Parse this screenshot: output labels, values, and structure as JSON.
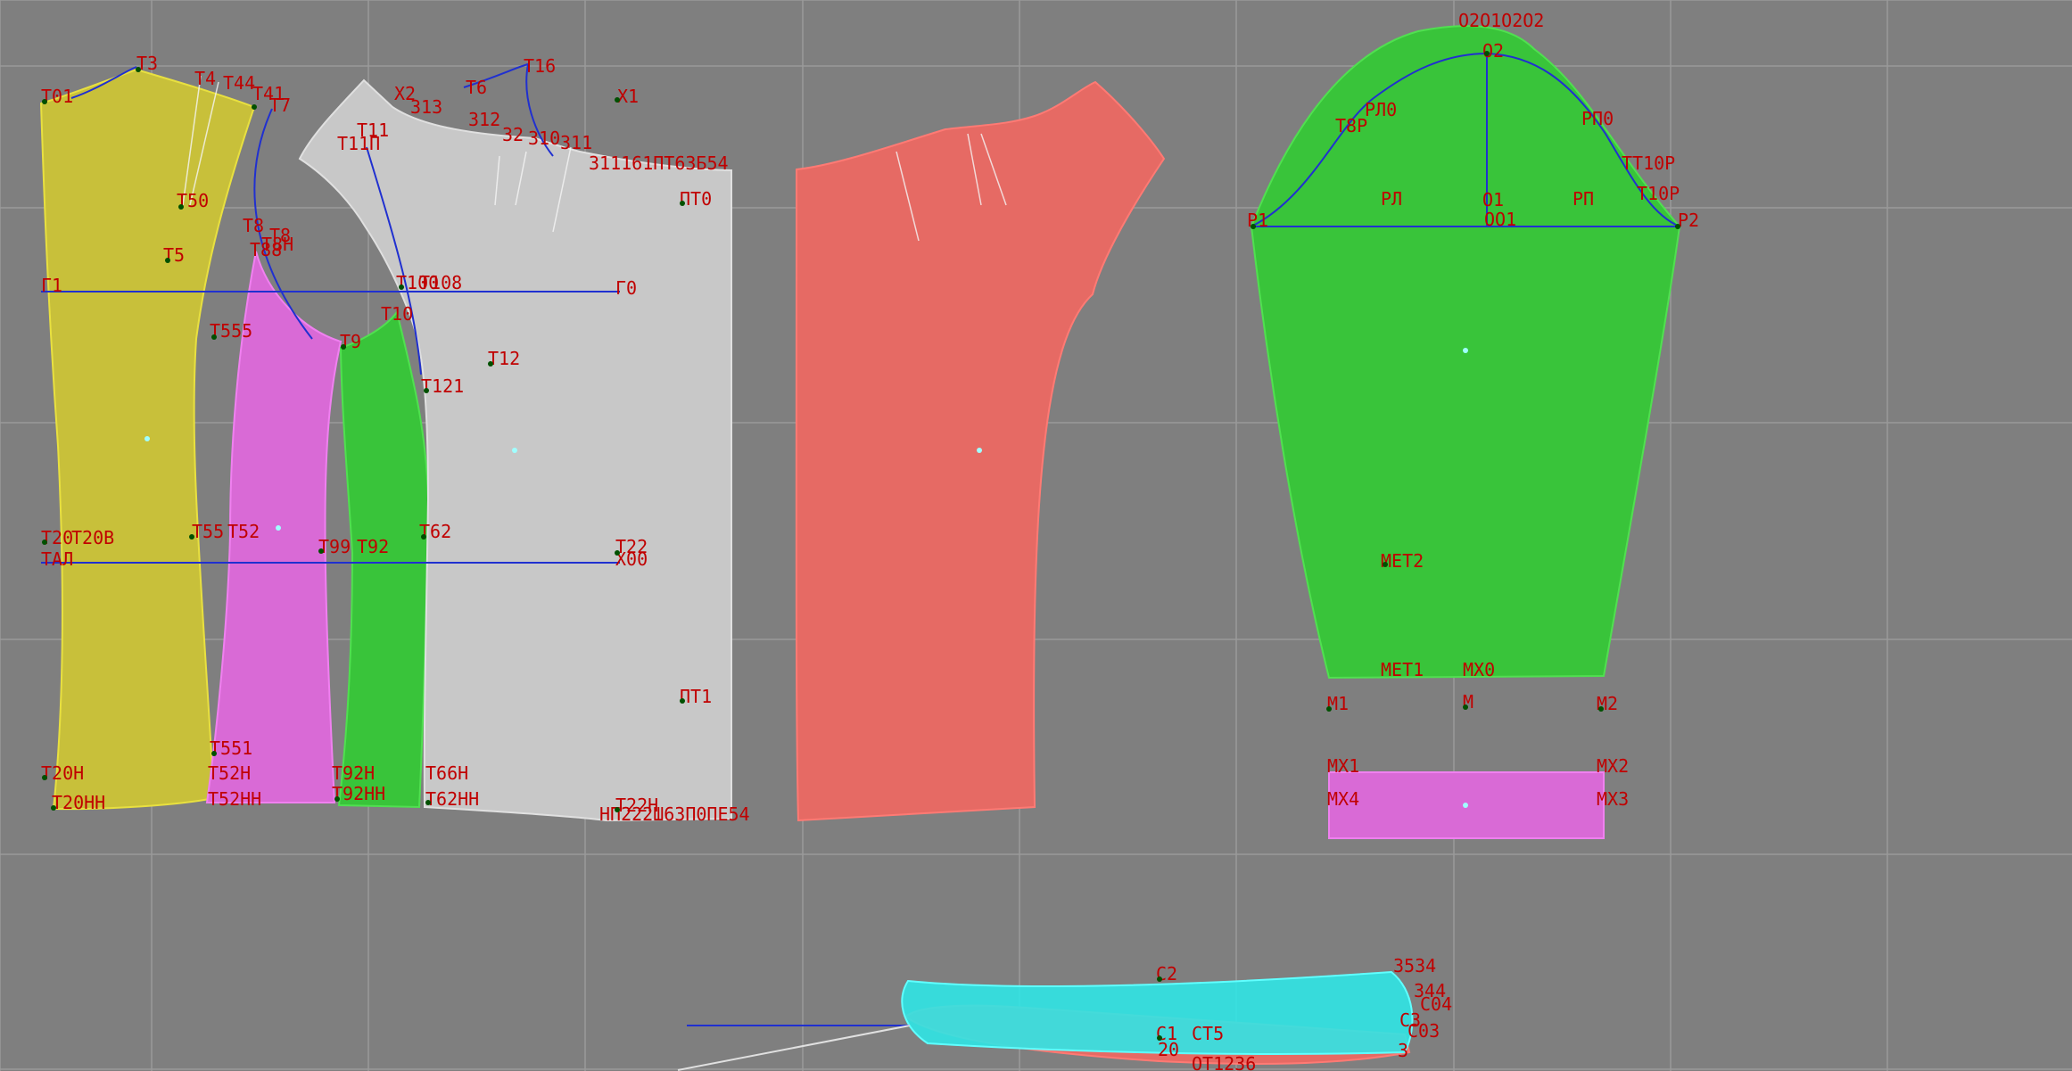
{
  "app": {
    "view": "pattern layout workspace"
  },
  "colors": {
    "background": "#7f7f7f",
    "grid": "#9a9a9a",
    "label": "#c00000",
    "yellow_piece": "#c8c03a",
    "magenta_piece": "#d96ad6",
    "green_piece": "#39c43a",
    "white_piece": "#c8c8c8",
    "red_piece": "#e66a64",
    "cyan_piece": "#30e6e6",
    "construction_line": "#2030d0"
  },
  "labels": {
    "t01": "T01",
    "t3": "T3",
    "t4": "T4",
    "t44": "T44",
    "t41": "T41",
    "t7": "T7",
    "t50": "T50",
    "t5": "T5",
    "t8": "T8",
    "t8b": "T8",
    "t8n": "T8H",
    "t88": "T88",
    "g1": "Г1",
    "g0": "Г0",
    "t555": "T555",
    "t9": "T9",
    "t10": "T10",
    "t100": "T100",
    "t108": "T108",
    "t121": "T121",
    "t12": "T12",
    "t20": "T20",
    "t20b": "T20B",
    "tal": "TAЛ",
    "t55": "T55",
    "t52": "T52",
    "t99": "T99",
    "t92": "T92",
    "t62": "T62",
    "t22": "T22",
    "x00": "X00",
    "t551": "T551",
    "t20nn": "T20HH",
    "t20n": "T20H",
    "t52n": "T52H",
    "t52nn": "T52HH",
    "t92n": "T92H",
    "t92nn": "T92HH",
    "t66n": "T66H",
    "t62nn": "T62HH",
    "t22n": "T22H",
    "x2": "X2",
    "t6": "T6",
    "t16": "T16",
    "x1": "X1",
    "t11p": "T11П",
    "t11": "T11",
    "n32": "32",
    "n312": "312",
    "n310": "310",
    "n311": "311",
    "n313": "313",
    "pt0": "ПТ0",
    "pt1": "ПТ1",
    "tail54": "54",
    "top_row": "311161ПТ63Б54",
    "bottom_row": "НП222Ш63П0ПЕ54",
    "o20": "O2O1O2O2",
    "o2": "O2",
    "rl0": "РЛ0",
    "rp0": "РП0",
    "t8r": "T8P",
    "t10r": "T10P",
    "tt10r": "TT10P",
    "r1": "P1",
    "r2": "P2",
    "rl": "РЛ",
    "rp": "РП",
    "o1": "O1",
    "o01": "OO1",
    "met2": "MET2",
    "met1": "MET1",
    "mx0": "MX0",
    "m1": "M1",
    "m": "M",
    "m2": "M2",
    "mx1": "MX1",
    "mx2": "MX2",
    "mx4": "MX4",
    "mx3": "MX3",
    "c2": "C2",
    "c1": "C1",
    "ct5": "CT5",
    "n3534": "3534",
    "n3": "3",
    "n20": "20",
    "ot1236": "OT1236",
    "c04": "C04",
    "c03": "C03",
    "c3": "C3",
    "n344": "344"
  }
}
